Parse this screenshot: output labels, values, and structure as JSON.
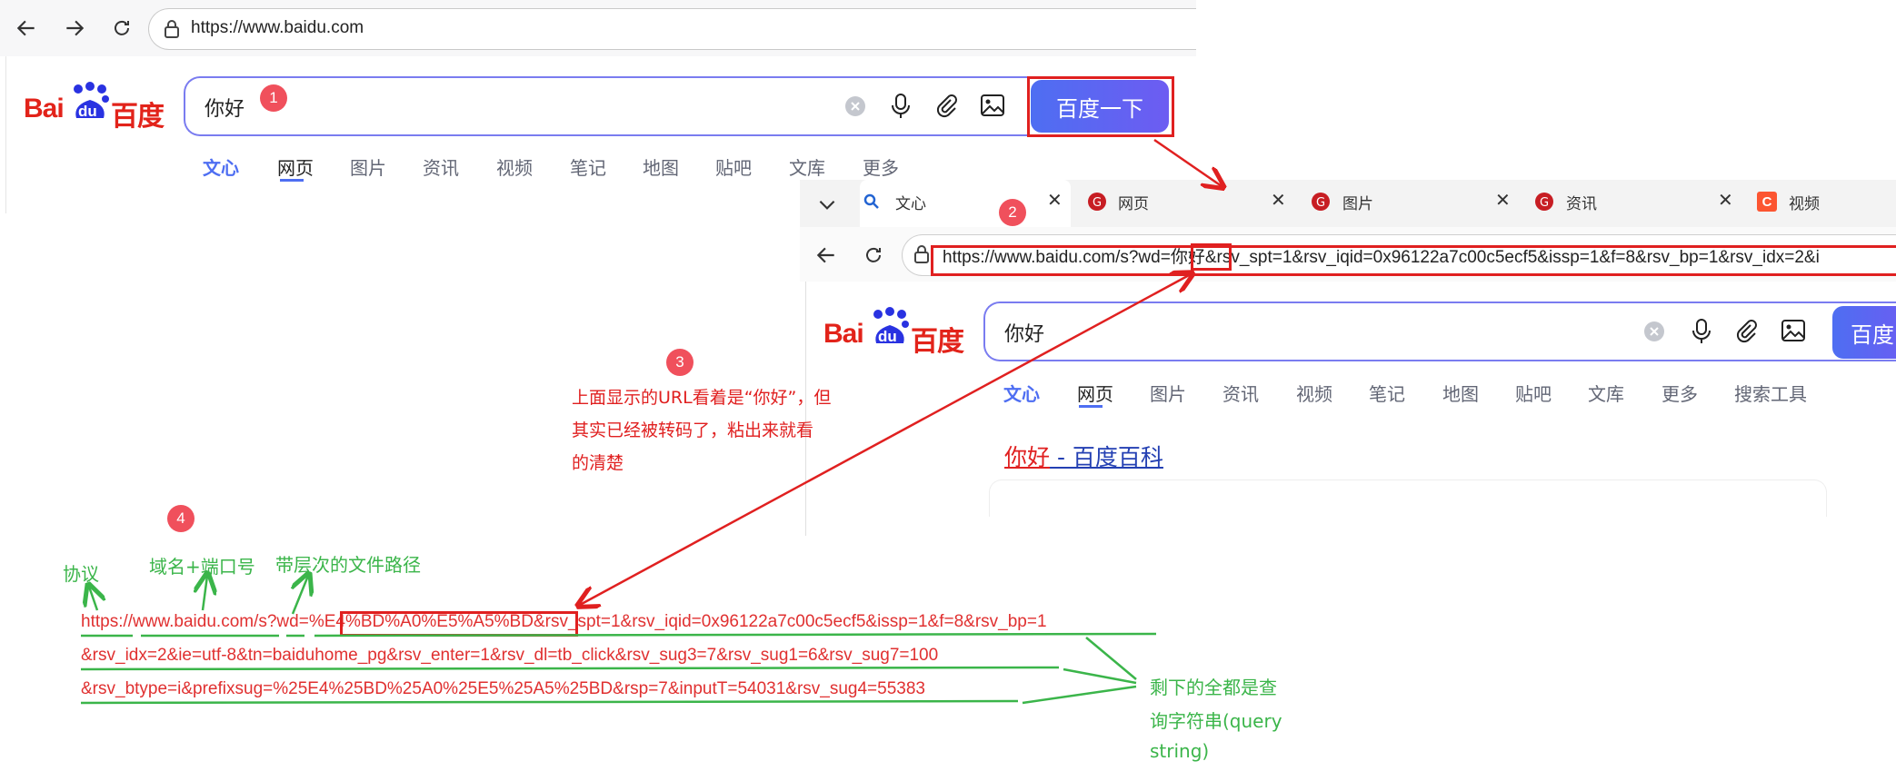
{
  "browser1": {
    "url": "https://www.baidu.com",
    "logo_text_left": "Bai",
    "logo_text_mid": "du",
    "logo_text_right": "百度",
    "query": "你好",
    "search_button": "百度一下",
    "tabs": [
      "文心",
      "网页",
      "图片",
      "资讯",
      "视频",
      "笔记",
      "地图",
      "贴吧",
      "文库",
      "更多"
    ]
  },
  "browser2": {
    "tabs": [
      "文心",
      "网页",
      "图片",
      "资讯",
      "视频",
      "笔记",
      "地图",
      "贴吧",
      "文库",
      "更多",
      "搜索工具"
    ],
    "url_prefix": "https://www.baidu.com/s?wd=",
    "url_highlight": "你好",
    "url_suffix": "&rsv_spt=1&rsv_iqid=0x96122a7c00c5ecf5&issp=1&f=8&rsv_bp=1&rsv_idx=2&i",
    "logo_text_left": "Bai",
    "logo_text_mid": "du",
    "logo_text_right": "百度",
    "query": "你好",
    "search_button": "百度",
    "result_title_red": "你好",
    "result_title_blue": " - 百度百科"
  },
  "annotations": {
    "badges": [
      "1",
      "2",
      "3",
      "4"
    ],
    "note3": [
      "上面显示的URL看着是“你好”，但",
      "其实已经被转码了，粘出来就看",
      "的清楚"
    ],
    "label_protocol": "协议",
    "label_domain": "域名+端口号",
    "label_path": "带层次的文件路径",
    "label_query": [
      "剩下的全都是查",
      "询字符串(query",
      "string)"
    ],
    "url_line1_a": "https://www.baidu.com/s?wd=",
    "url_line1_b": "%E4%BD%A0%E5%A5%BD",
    "url_line1_c": "&rsv_spt=1&rsv_iqid=0x96122a7c00c5ecf5&issp=1&f=8&rsv_bp=1",
    "url_line2": "&rsv_idx=2&ie=utf-8&tn=baiduhome_pg&rsv_enter=1&rsv_dl=tb_click&rsv_sug3=7&rsv_sug1=6&rsv_sug7=100",
    "url_line3": "&rsv_btype=i&prefixsug=%25E4%25BD%25A0%25E5%25A5%25BD&rsp=7&inputT=54031&rsv_sug4=55383"
  },
  "colors": {
    "accent_blue": "#4e6ef2",
    "annotation_red": "#e02020",
    "annotation_green": "#3bb54a"
  }
}
